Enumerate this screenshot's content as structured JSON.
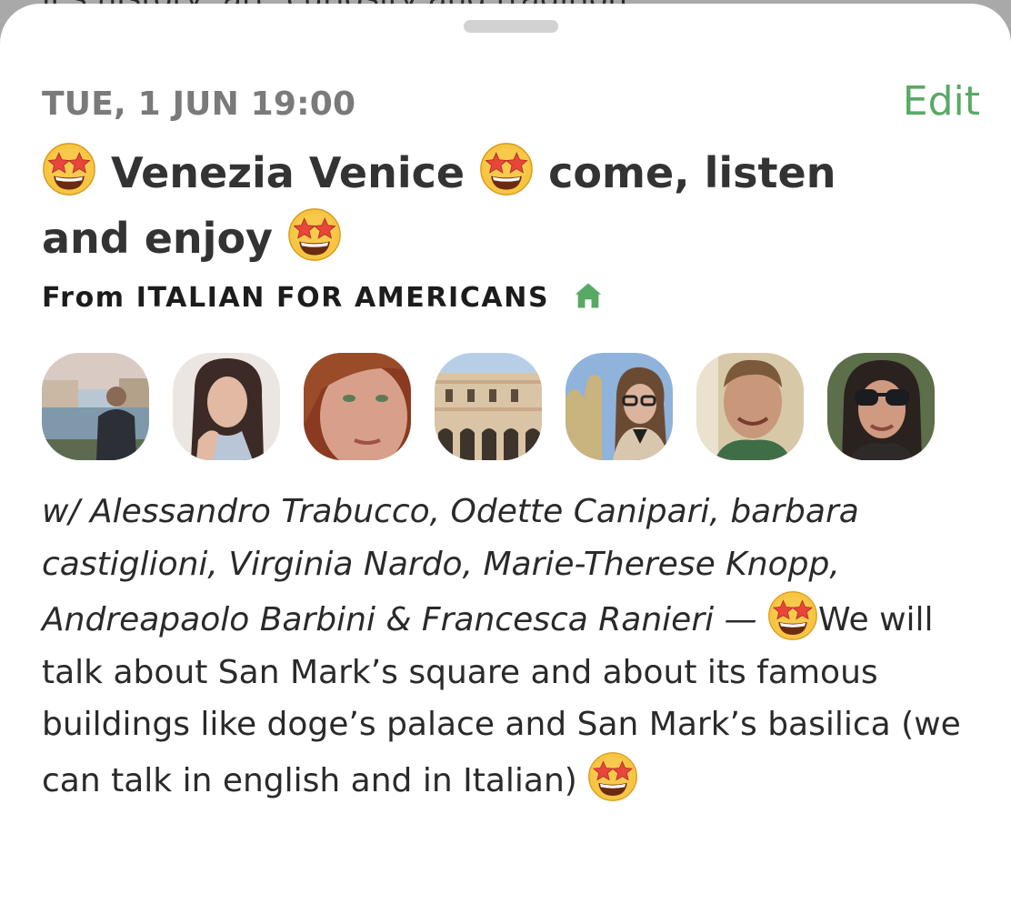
{
  "behind": {
    "text": "it's history, art, curiosity and tradition"
  },
  "event": {
    "date": "TUE, 1 JUN 19:00",
    "edit_label": "Edit",
    "title_part1": "Venezia Venice",
    "title_part2": "come, listen",
    "title_part3": "and enjoy",
    "club_prefix": "From",
    "club_name": "ITALIAN FOR AMERICANS",
    "with_prefix": "w/",
    "speakers_text": "Alessandro Trabucco, Odette Canipari, barbara castiglioni, Virginia Nardo, Marie-Therese Knopp, Andreapaolo Barbini & Francesca Ranieri —",
    "desc_after_emoji": "We will talk about San Mark’s square and about its famous buildings like doge’s palace and San Mark’s basilica (we can talk in english and in Italian)"
  },
  "icons": {
    "emoji": "star-struck-emoji",
    "club": "house-icon"
  },
  "colors": {
    "accent_green": "#58a965",
    "date_gray": "#7a7a7a",
    "title_dark": "#333333"
  }
}
